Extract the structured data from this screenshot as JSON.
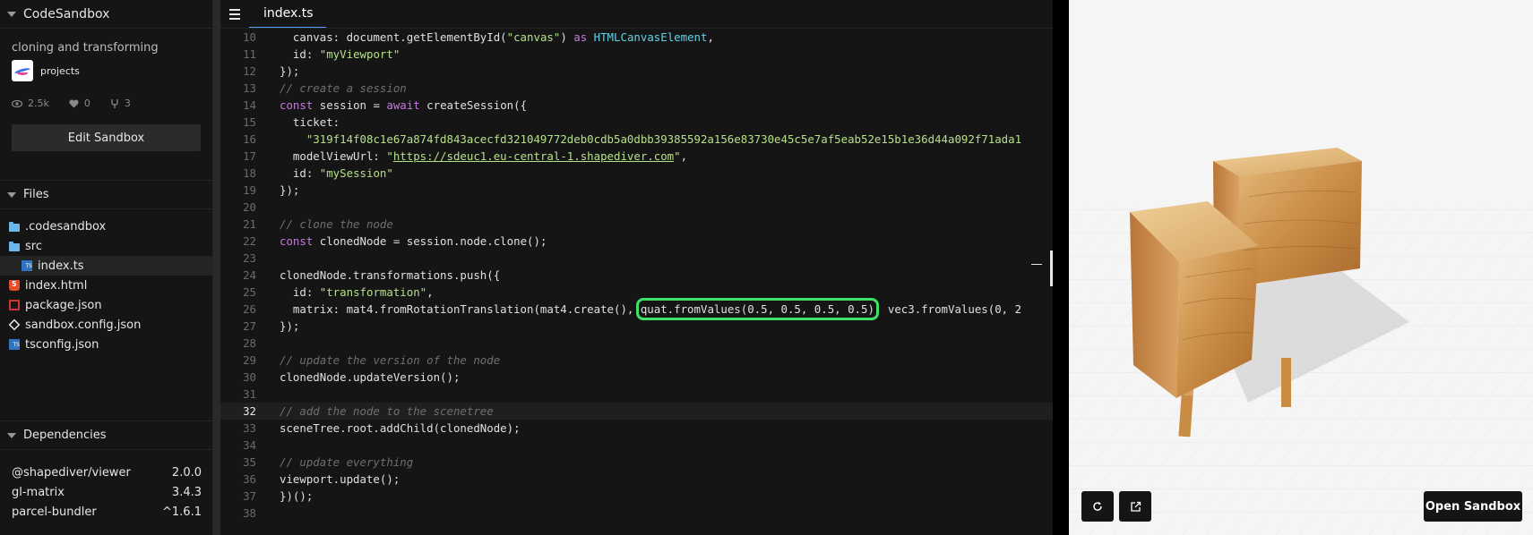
{
  "sidebar": {
    "app_title": "CodeSandbox",
    "sandbox_title": "cloning and transforming",
    "owner": "projects",
    "stats": {
      "views": "2.5k",
      "likes": "0",
      "forks": "3"
    },
    "edit_button": "Edit Sandbox",
    "files_header": "Files",
    "files": [
      {
        "name": ".codesandbox",
        "icon": "folder-icon"
      },
      {
        "name": "src",
        "icon": "folder-icon"
      },
      {
        "name": "index.ts",
        "icon": "typescript-file-icon",
        "active": true
      },
      {
        "name": "index.html",
        "icon": "html-file-icon"
      },
      {
        "name": "package.json",
        "icon": "npm-file-icon"
      },
      {
        "name": "sandbox.config.json",
        "icon": "config-file-icon"
      },
      {
        "name": "tsconfig.json",
        "icon": "typescript-file-icon"
      }
    ],
    "dependencies_header": "Dependencies",
    "dependencies": [
      {
        "name": "@shapediver/viewer",
        "version": "2.0.0"
      },
      {
        "name": "gl-matrix",
        "version": "3.4.3"
      },
      {
        "name": "parcel-bundler",
        "version": "^1.6.1"
      }
    ]
  },
  "editor": {
    "tab": "index.ts",
    "current_line": 32,
    "lines": [
      {
        "n": "10",
        "t": "  canvas: document.getElementById(\"canvas\") as HTMLCanvasElement,"
      },
      {
        "n": "11",
        "t": "  id: \"myViewport\""
      },
      {
        "n": "12",
        "t": "});"
      },
      {
        "n": "13",
        "t": "// create a session"
      },
      {
        "n": "14",
        "t": "const session = await createSession({"
      },
      {
        "n": "15",
        "t": "  ticket:"
      },
      {
        "n": "16",
        "t": "    \"319f14f08c1e67a874fd843acecfd321049772deb0cdb5a0dbb39385592a156e83730e45c5e7af5eab52e15b1e36d44a092f71ada1"
      },
      {
        "n": "17",
        "t": "  modelViewUrl: \"https://sdeuc1.eu-central-1.shapediver.com\","
      },
      {
        "n": "18",
        "t": "  id: \"mySession\""
      },
      {
        "n": "19",
        "t": "});"
      },
      {
        "n": "20",
        "t": ""
      },
      {
        "n": "21",
        "t": "// clone the node"
      },
      {
        "n": "22",
        "t": "const clonedNode = session.node.clone();"
      },
      {
        "n": "23",
        "t": ""
      },
      {
        "n": "24",
        "t": "clonedNode.transformations.push({"
      },
      {
        "n": "25",
        "t": "  id: \"transformation\","
      },
      {
        "n": "26",
        "t": "  matrix: mat4.fromRotationTranslation(mat4.create(), quat.fromValues(0.5, 0.5, 0.5, 0.5), vec3.fromValues(0, 2"
      },
      {
        "n": "27",
        "t": "});"
      },
      {
        "n": "28",
        "t": ""
      },
      {
        "n": "29",
        "t": "// update the version of the node"
      },
      {
        "n": "30",
        "t": "clonedNode.updateVersion();"
      },
      {
        "n": "31",
        "t": ""
      },
      {
        "n": "32",
        "t": "// add the node to the scenetree"
      },
      {
        "n": "33",
        "t": "sceneTree.root.addChild(clonedNode);"
      },
      {
        "n": "34",
        "t": ""
      },
      {
        "n": "35",
        "t": "// update everything"
      },
      {
        "n": "36",
        "t": "viewport.update();"
      },
      {
        "n": "37",
        "t": "})();"
      },
      {
        "n": "38",
        "t": ""
      }
    ],
    "highlight": "quat.fromValues(0.5, 0.5, 0.5, 0.5)",
    "highlight_color": "#3ee266"
  },
  "preview": {
    "refresh_icon": "refresh-icon",
    "open_new_window_icon": "external-link-icon",
    "open_button": "Open Sandbox"
  }
}
